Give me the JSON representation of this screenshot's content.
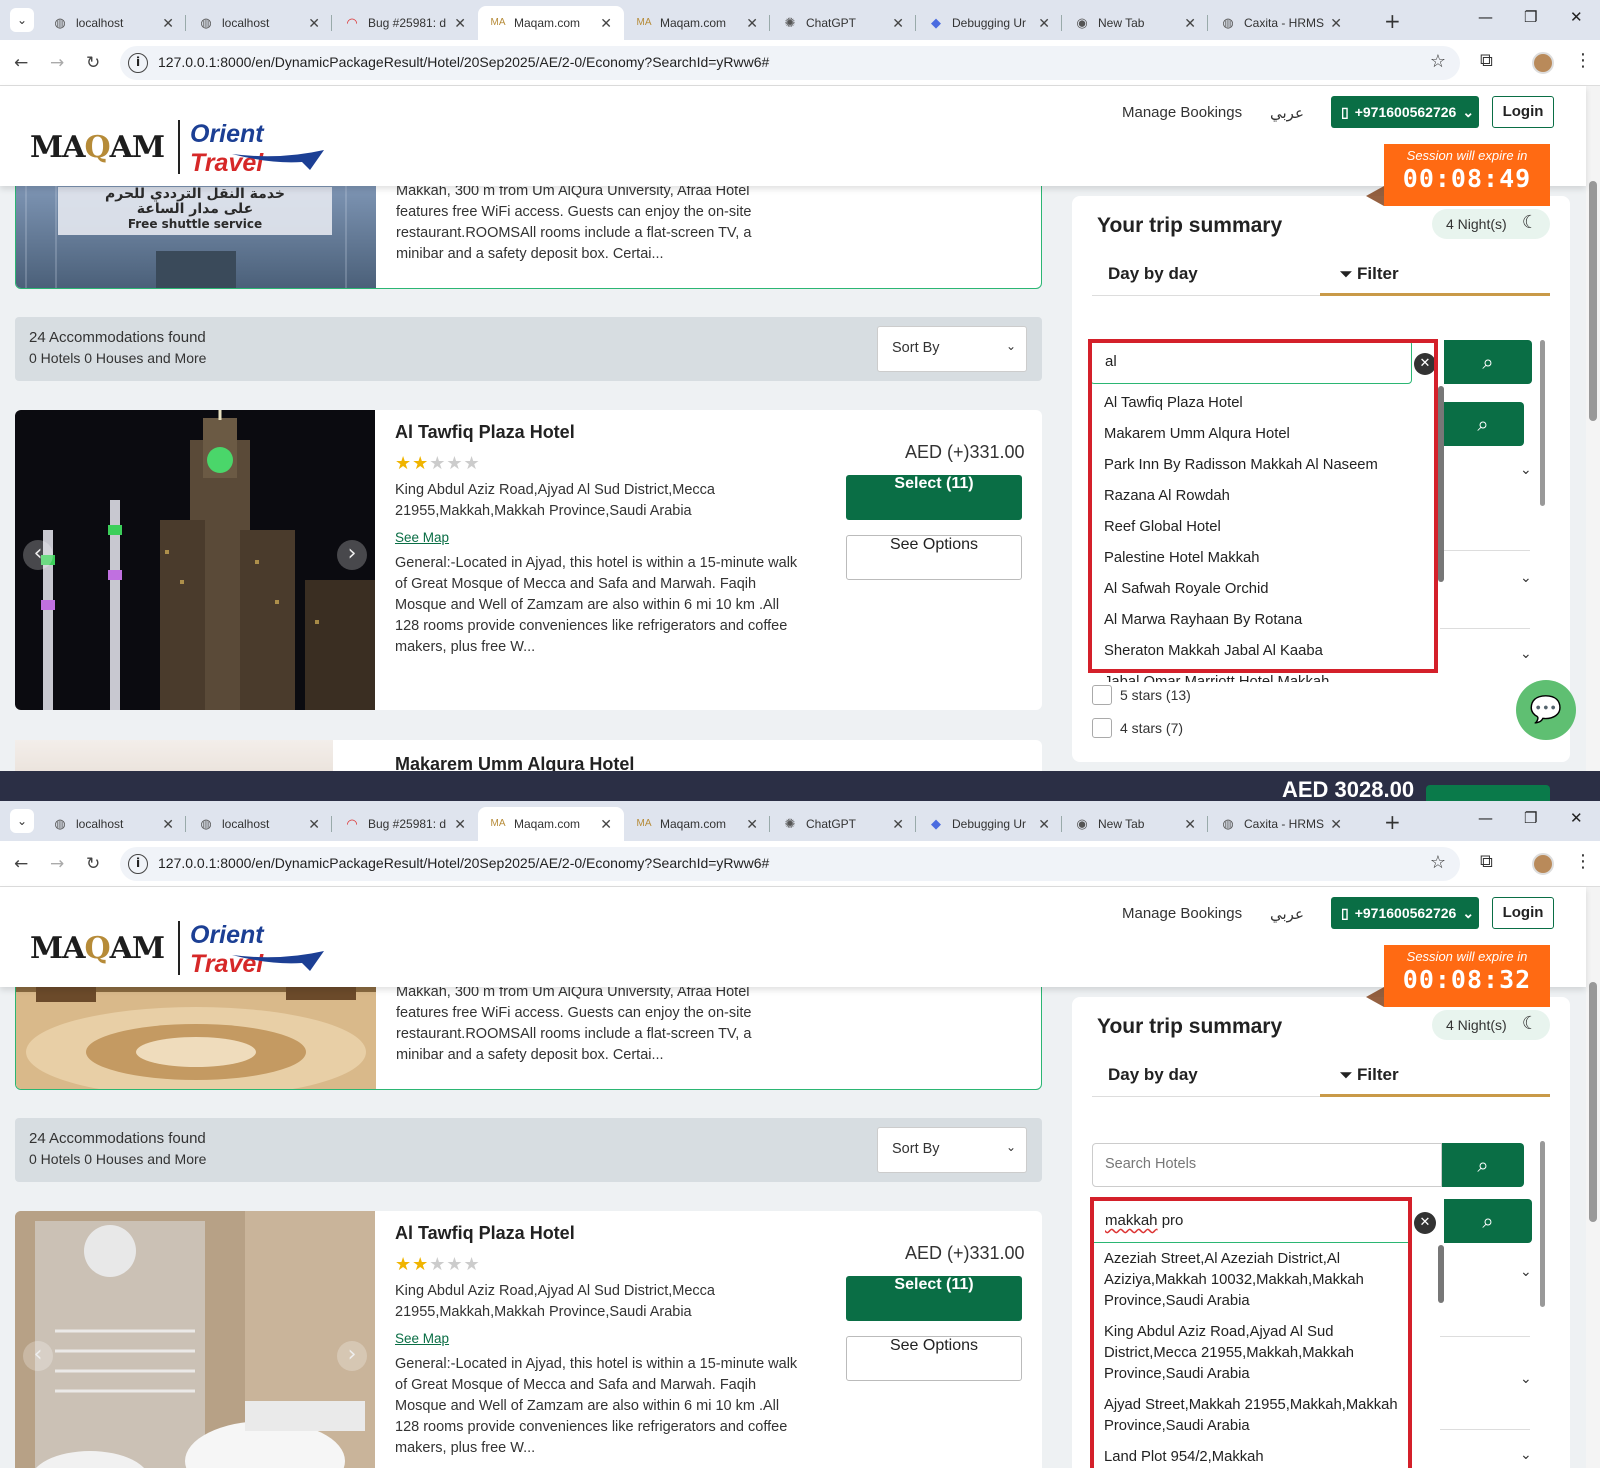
{
  "browser": {
    "tabs": [
      {
        "title": "localhost",
        "icon": "globe-icon"
      },
      {
        "title": "localhost",
        "icon": "globe-icon"
      },
      {
        "title": "Bug #25981: d",
        "icon": "bug-tracker-icon"
      },
      {
        "title": "Maqam.com",
        "icon": "maqam-icon",
        "active": true
      },
      {
        "title": "Maqam.com",
        "icon": "maqam-icon"
      },
      {
        "title": "ChatGPT",
        "icon": "chatgpt-icon"
      },
      {
        "title": "Debugging Ur",
        "icon": "debug-icon"
      },
      {
        "title": "New Tab",
        "icon": "chrome-icon"
      },
      {
        "title": "Caxita - HRMS",
        "icon": "globe-icon"
      }
    ],
    "url": "127.0.0.1:8000/en/DynamicPackageResult/Hotel/20Sep2025/AE/2-0/Economy?SearchId=yRww6#"
  },
  "header": {
    "logo_maqam": "MAQAM",
    "logo_orient": "Orient",
    "logo_travel": "Travel",
    "manage_bookings": "Manage Bookings",
    "arabic": "عربي",
    "phone": "+971600562726",
    "login": "Login",
    "session_label": "Session will expire in"
  },
  "results": {
    "top_card_desc": "Makkah, 300 m from Um AlQura University, Afraa Hotel features free WiFi access. Guests can enjoy the on-site restaurant.ROOMSAll rooms include a flat-screen TV, a minibar and a safety deposit box. Certai...",
    "top_card_banner_ar1": "خدمة النقل الترددي للحرم",
    "top_card_banner_ar2": "على مدار الساعة",
    "top_card_banner_en": "Free shuttle service",
    "found_count": "24 Accommodations found",
    "found_breakdown": "0 Hotels 0 Houses and More",
    "sort_label": "Sort By",
    "hotel": {
      "name": "Al Tawfiq Plaza Hotel",
      "stars": 2,
      "address": "King Abdul Aziz Road,Ajyad Al Sud District,Mecca 21955,Makkah,Makkah Province,Saudi Arabia",
      "see_map": "See Map",
      "description": "General:-Located in Ajyad, this hotel is within a 15-minute walk of Great Mosque of Mecca and Safa and Marwah. Faqih Mosque and Well of Zamzam are also within 6 mi 10 km .All 128 rooms provide conveniences like refrigerators and coffee makers, plus free W...",
      "price": "AED (+)331.00",
      "select": "Select (11)",
      "see_options": "See Options"
    },
    "next_hotel": "Makarem Umm Alqura Hotel",
    "strip_total": "AED 3028.00"
  },
  "side": {
    "title": "Your trip summary",
    "nights": "4 Night(s)",
    "tab_day": "Day by day",
    "tab_filter": "Filter",
    "search_placeholder": "Search Hotels",
    "star_filters": [
      "5 stars (13)",
      "4 stars (7)"
    ]
  },
  "screen1": {
    "timer": "00:08:49",
    "query": "al",
    "suggestions": [
      "Al Tawfiq Plaza Hotel",
      "Makarem Umm Alqura Hotel",
      "Park Inn By Radisson Makkah Al Naseem",
      "Razana Al Rowdah",
      "Reef Global Hotel",
      "Palestine Hotel Makkah",
      "Al Safwah Royale Orchid",
      "Al Marwa Rayhaan By Rotana",
      "Sheraton Makkah Jabal Al Kaaba",
      "Jabal Omar Marriott Hotel Makkah"
    ]
  },
  "screen2": {
    "timer": "00:08:32",
    "query_word": "makkah",
    "query_rest": " pro",
    "suggestions": [
      "Azeziah Street,Al Azeziah District,Al Aziziya,Makkah 10032,Makkah,Makkah Province,Saudi Arabia",
      "King Abdul Aziz Road,Ajyad Al Sud District,Mecca 21955,Makkah,Makkah Province,Saudi Arabia",
      "Ajyad Street,Makkah 21955,Makkah,Makkah Province,Saudi Arabia",
      "Land Plot 954/2,Makkah"
    ]
  },
  "colors": {
    "brand_green": "#0a6e45",
    "session_orange": "#ff6a13",
    "highlight_red": "#d4202a",
    "filter_underline": "#c99a48"
  }
}
